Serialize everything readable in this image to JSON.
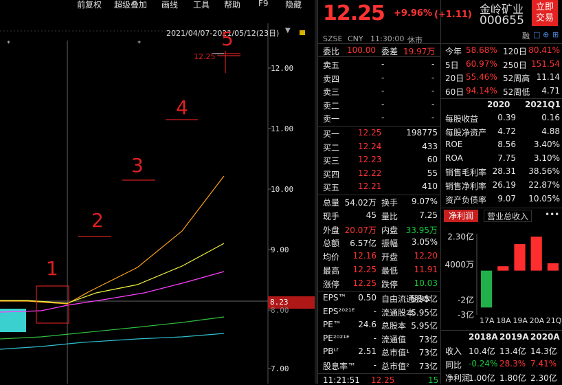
{
  "menu": [
    "前复权",
    "超级叠加",
    "画线",
    "工具",
    "帮助",
    "F9",
    "隐藏"
  ],
  "chart": {
    "date_range": "2021/04/07-2021/05/12(23日)",
    "y_ticks": [
      "12.00",
      "11.00",
      "10.00",
      "9.00",
      "8.00",
      "7.00"
    ],
    "price_flag": "8.23",
    "target_label": "12.25",
    "annotations": [
      "1",
      "2",
      "3",
      "4",
      "5"
    ],
    "star": "*"
  },
  "quote": {
    "price": "12.25",
    "change_pct": "+9.96%",
    "change_amt": "(+1.11)",
    "name": "金岭矿业",
    "code": "000655",
    "trade_btn": "立即交易",
    "market": "SZSE",
    "currency": "CNY",
    "time": "11:30:00",
    "status": "休市",
    "icon_labels": [
      "融",
      "□",
      "⊕",
      "⊞"
    ]
  },
  "book": {
    "weibi_label": "委比",
    "weibi": "100.00",
    "weicha_label": "委差",
    "weicha": "19.97万",
    "asks": [
      {
        "label": "卖五",
        "price": "-",
        "vol": "-"
      },
      {
        "label": "卖四",
        "price": "-",
        "vol": "-"
      },
      {
        "label": "卖三",
        "price": "-",
        "vol": "-"
      },
      {
        "label": "卖二",
        "price": "-",
        "vol": "-"
      },
      {
        "label": "卖一",
        "price": "-",
        "vol": "-"
      }
    ],
    "bids": [
      {
        "label": "买一",
        "price": "12.25",
        "vol": "198775"
      },
      {
        "label": "买二",
        "price": "12.24",
        "vol": "433"
      },
      {
        "label": "买三",
        "price": "12.23",
        "vol": "60"
      },
      {
        "label": "买四",
        "price": "12.22",
        "vol": "55"
      },
      {
        "label": "买五",
        "price": "12.21",
        "vol": "410"
      }
    ]
  },
  "stats": [
    {
      "l1": "总量",
      "v1": "54.02万",
      "l2": "换手",
      "v2": "9.07%",
      "c1": "white",
      "c2": "white"
    },
    {
      "l1": "现手",
      "v1": "45",
      "l2": "量比",
      "v2": "7.25",
      "c1": "white",
      "c2": "white"
    },
    {
      "l1": "外盘",
      "v1": "20.07万",
      "l2": "内盘",
      "v2": "33.95万",
      "c1": "red",
      "c2": "green"
    },
    {
      "l1": "总额",
      "v1": "6.57亿",
      "l2": "振幅",
      "v2": "3.05%",
      "c1": "white",
      "c2": "white"
    },
    {
      "l1": "均价",
      "v1": "12.16",
      "l2": "开盘",
      "v2": "12.20",
      "c1": "red",
      "c2": "red"
    },
    {
      "l1": "最高",
      "v1": "12.25",
      "l2": "最低",
      "v2": "11.91",
      "c1": "red",
      "c2": "red"
    },
    {
      "l1": "涨停",
      "v1": "12.25",
      "l2": "跌停",
      "v2": "10.03",
      "c1": "red",
      "c2": "green"
    }
  ],
  "fundamentals": [
    {
      "l1": "EPS™",
      "v1": "0.50",
      "l2": "自由流通股本",
      "v2": "5.95亿"
    },
    {
      "l1": "EPS²⁰²¹ᴱ",
      "v1": "-",
      "l2": "流通股本",
      "v2": "5.95亿"
    },
    {
      "l1": "PE™",
      "v1": "24.6",
      "l2": "总股本",
      "v2": "5.95亿"
    },
    {
      "l1": "PE²⁰²¹ᴱ",
      "v1": "-",
      "l2": "流通值",
      "v2": "73亿"
    },
    {
      "l1": "PBᴸᶠ",
      "v1": "2.51",
      "l2": "总市值¹",
      "v2": "73亿"
    },
    {
      "l1": "股息率™",
      "v1": "-",
      "l2": "总市值²",
      "v2": "73亿"
    }
  ],
  "tick": {
    "time": "11:21:51",
    "price": "12.25",
    "vol": "15"
  },
  "performance": [
    {
      "l1": "今年",
      "v1": "58.68%",
      "l2": "120日",
      "v2": "80.41%"
    },
    {
      "l1": "5日",
      "v1": "60.97%",
      "l2": "250日",
      "v2": "151.54"
    },
    {
      "l1": "20日",
      "v1": "55.46%",
      "l2": "52周高",
      "v2": "11.14"
    },
    {
      "l1": "60日",
      "v1": "94.14%",
      "l2": "52周低",
      "v2": "4.71"
    }
  ],
  "fin_table": {
    "headers": [
      "2020",
      "2021Q1"
    ],
    "rows": [
      {
        "label": "每股收益",
        "a": "0.39",
        "b": "0.16"
      },
      {
        "label": "每股净资产",
        "a": "4.72",
        "b": "4.88"
      },
      {
        "label": "ROE",
        "a": "8.56",
        "b": "3.40%"
      },
      {
        "label": "ROA",
        "a": "7.75",
        "b": "3.10%"
      },
      {
        "label": "销售毛利率",
        "a": "28.31",
        "b": "38.56%"
      },
      {
        "label": "销售净利率",
        "a": "26.19",
        "b": "22.87%"
      },
      {
        "label": "资产负债率",
        "a": "9.07",
        "b": "10.05%"
      }
    ]
  },
  "profit_tabs": [
    "净利润",
    "营业总收入",
    "•••"
  ],
  "chart_data": {
    "type": "bar",
    "categories": [
      "17A",
      "18A",
      "19A",
      "20A",
      "21Q1"
    ],
    "values": [
      -2.5,
      0.3,
      1.8,
      2.3,
      0.5
    ],
    "y_tick_labels": [
      "2.30亿",
      "4000万",
      "-2亿",
      "-3亿"
    ],
    "ylim": [
      -3,
      2.5
    ],
    "unit": "亿",
    "colors": {
      "positive": "#ff2e2e",
      "negative": "#22b04a"
    }
  },
  "bottom_table": {
    "headers": [
      "2018A",
      "2019A",
      "2020A"
    ],
    "rows": [
      {
        "label": "收入",
        "vals": [
          "10.4亿",
          "13.4亿",
          "14.3亿"
        ],
        "colors": [
          "white",
          "white",
          "white"
        ]
      },
      {
        "label": "同比",
        "vals": [
          "-0.24%",
          "28.3%",
          "7.41%"
        ],
        "colors": [
          "green",
          "red",
          "red"
        ]
      },
      {
        "label": "净利润",
        "vals": [
          "1.00亿",
          "1.80亿",
          "2.30亿"
        ],
        "colors": [
          "white",
          "white",
          "white"
        ]
      }
    ]
  }
}
